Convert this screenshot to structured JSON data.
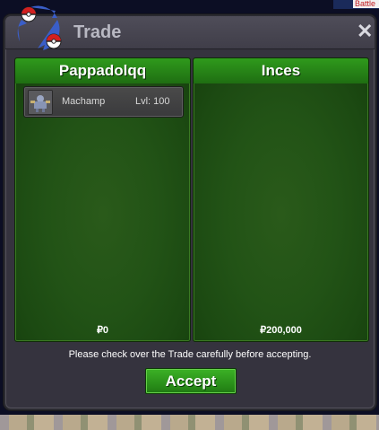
{
  "background": {
    "battle_tag": "Battle"
  },
  "window": {
    "title": "Trade",
    "close_label": "✕"
  },
  "left_panel": {
    "trader_name": "Pappadolqq",
    "pokemon": [
      {
        "name": "Machamp",
        "level": "Lvl: 100"
      }
    ],
    "money": "₽0"
  },
  "right_panel": {
    "trader_name": "Inces",
    "pokemon": [],
    "money": "₽200,000"
  },
  "notice": "Please check over the Trade carefully before accepting.",
  "accept_label": "Accept",
  "colors": {
    "panel_green": "#225316",
    "header_green": "#2f9a1c",
    "button_green": "#3cb226",
    "window_bg": "#35333e"
  }
}
